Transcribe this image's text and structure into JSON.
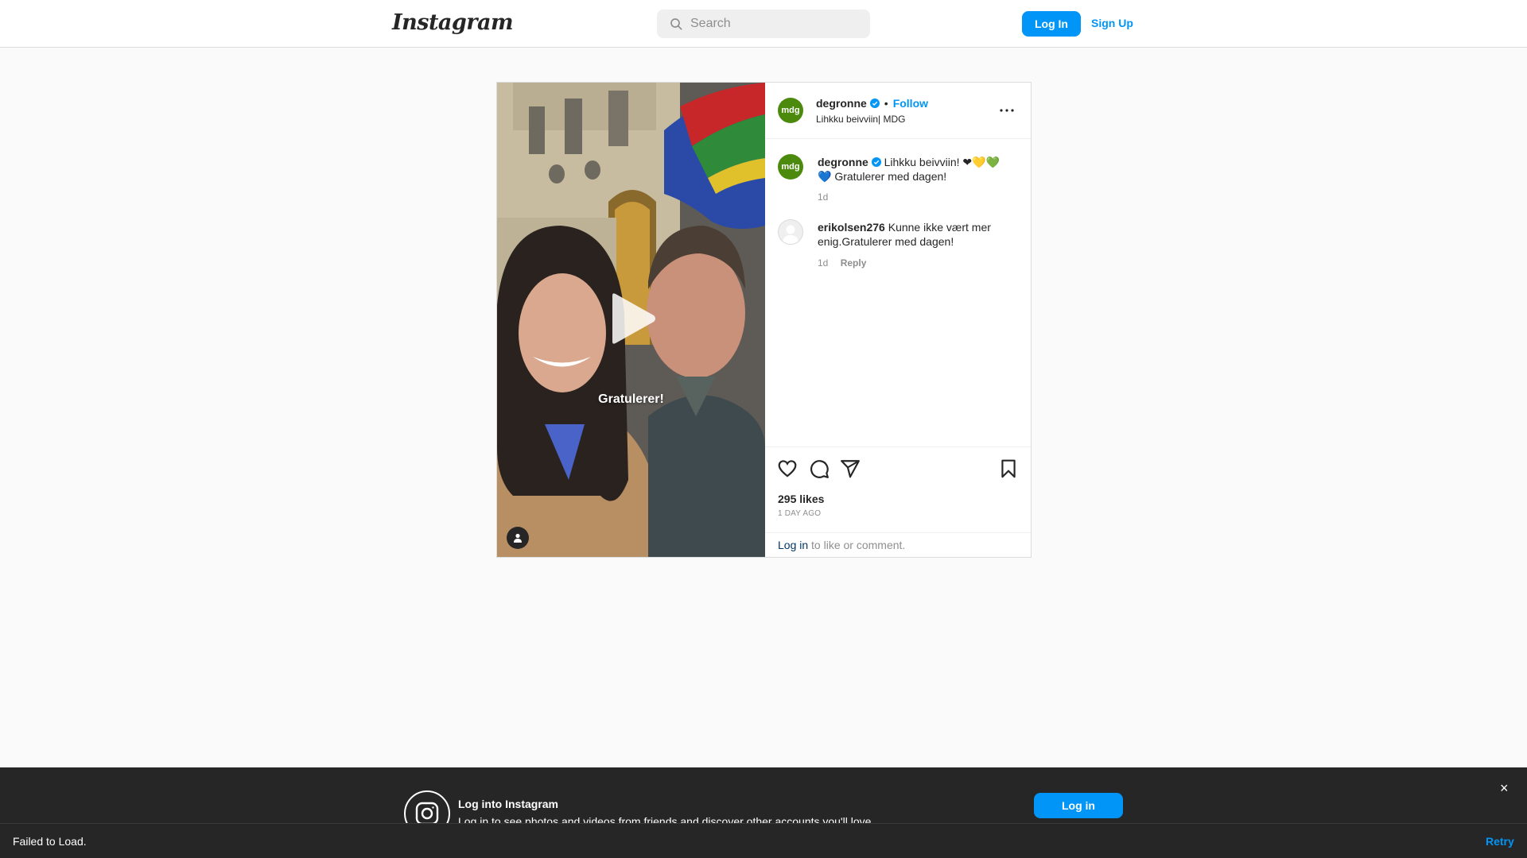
{
  "header": {
    "logo": "Instagram",
    "search_placeholder": "Search",
    "login_label": "Log In",
    "signup_label": "Sign Up"
  },
  "post": {
    "overlay_text": "Gratulerer!",
    "author": {
      "avatar_text": "mdg",
      "username": "degronne",
      "separator": "•",
      "follow_label": "Follow",
      "subtitle": "Lihkku beivviin| MDG"
    },
    "comments": [
      {
        "avatar_text": "mdg",
        "username": "degronne",
        "text": "Lihkku beivviin! ❤💛💚💙 Gratulerer med dagen!",
        "time": "1d"
      },
      {
        "username": "erikolsen276",
        "text": "Kunne ikke vært mer enig.Gratulerer med dagen!",
        "time": "1d",
        "reply_label": "Reply"
      }
    ],
    "likes": "295 likes",
    "time_ago": "1 DAY AGO",
    "login_link": "Log in",
    "login_rest": " to like or comment."
  },
  "banner": {
    "title": "Log into Instagram",
    "subtitle": "Log in to see photos and videos from friends and discover other accounts you'll love.",
    "login_label": "Log in",
    "close_label": "×"
  },
  "error_bar": {
    "message": "Failed to Load.",
    "retry_label": "Retry"
  },
  "colors": {
    "accent": "#0095f6",
    "mdg_green": "#4c8a0e",
    "dark": "#262626"
  }
}
